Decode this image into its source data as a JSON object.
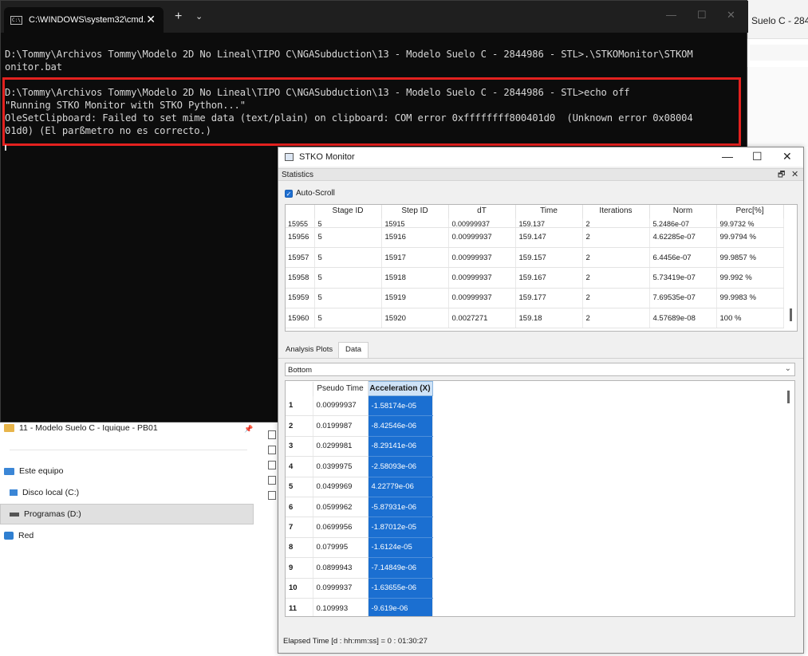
{
  "explorer": {
    "bg_window_title": "Suelo C - 2844",
    "nav": {
      "folder_item": "11 - Modelo Suelo C - Iquique - PB01",
      "this_pc": "Este equipo",
      "disk_c": "Disco local (C:)",
      "disk_d": "Programas (D:)",
      "network": "Red"
    }
  },
  "cmd": {
    "tab_title": "C:\\WINDOWS\\system32\\cmd.",
    "tab_close": "✕",
    "new_tab": "+",
    "dropdown": "⌄",
    "win_min": "—",
    "win_max": "☐",
    "win_close": "✕",
    "lines": [
      "D:\\Tommy\\Archivos Tommy\\Modelo 2D No Lineal\\TIPO C\\NGASubduction\\13 - Modelo Suelo C - 2844986 - STL>.\\STKOMonitor\\STKOM",
      "onitor.bat",
      "D:\\Tommy\\Archivos Tommy\\Modelo 2D No Lineal\\TIPO C\\NGASubduction\\13 - Modelo Suelo C - 2844986 - STL>echo off",
      "\"Running STKO Monitor with STKO Python...\"",
      "OleSetClipboard: Failed to set mime data (text/plain) on clipboard: COM error 0xffffffff800401d0  (Unknown error 0x08004",
      "01d0) (El parßmetro no es correcto.)"
    ]
  },
  "stko": {
    "title": "STKO Monitor",
    "win_min": "—",
    "win_max": "☐",
    "win_close": "✕",
    "statistics_label": "Statistics",
    "float_btn": "🗗",
    "close_btn": "✕",
    "autoscroll_label": "Auto-Scroll",
    "autoscroll_check": "✓",
    "stats_columns": [
      "Stage ID",
      "Step ID",
      "dT",
      "Time",
      "Iterations",
      "Norm",
      "Perc[%]"
    ],
    "stats_partial_row": [
      "15955",
      "5",
      "15915",
      "0.00999937",
      "159.137",
      "2",
      "5.2486e-07",
      "99.9732 %"
    ],
    "stats_rows": [
      [
        "15956",
        "5",
        "15916",
        "0.00999937",
        "159.147",
        "2",
        "4.62285e-07",
        "99.9794 %"
      ],
      [
        "15957",
        "5",
        "15917",
        "0.00999937",
        "159.157",
        "2",
        "6.4456e-07",
        "99.9857 %"
      ],
      [
        "15958",
        "5",
        "15918",
        "0.00999937",
        "159.167",
        "2",
        "5.73419e-07",
        "99.992 %"
      ],
      [
        "15959",
        "5",
        "15919",
        "0.00999937",
        "159.177",
        "2",
        "7.69535e-07",
        "99.9983 %"
      ],
      [
        "15960",
        "5",
        "15920",
        "0.0027271",
        "159.18",
        "2",
        "4.57689e-08",
        "100 %"
      ]
    ],
    "tabs": [
      "Analysis Plots",
      "Data"
    ],
    "dropdown_value": "Bottom",
    "dropdown_chevron": "⌄",
    "data_columns": [
      "Pseudo Time",
      "Acceleration (X)"
    ],
    "data_rows": [
      [
        "1",
        "0.00999937",
        "-1.58174e-05"
      ],
      [
        "2",
        "0.0199987",
        "-8.42546e-06"
      ],
      [
        "3",
        "0.0299981",
        "-8.29141e-06"
      ],
      [
        "4",
        "0.0399975",
        "-2.58093e-06"
      ],
      [
        "5",
        "0.0499969",
        "4.22779e-06"
      ],
      [
        "6",
        "0.0599962",
        "-5.87931e-06"
      ],
      [
        "7",
        "0.0699956",
        "-1.87012e-05"
      ],
      [
        "8",
        "0.079995",
        "-1.6124e-05"
      ],
      [
        "9",
        "0.0899943",
        "-7.14849e-06"
      ],
      [
        "10",
        "0.0999937",
        "-1.63655e-06"
      ],
      [
        "11",
        "0.109993",
        "-9.619e-06"
      ]
    ],
    "elapsed": "Elapsed Time [d : hh:mm:ss] = 0 : 01:30:27"
  }
}
